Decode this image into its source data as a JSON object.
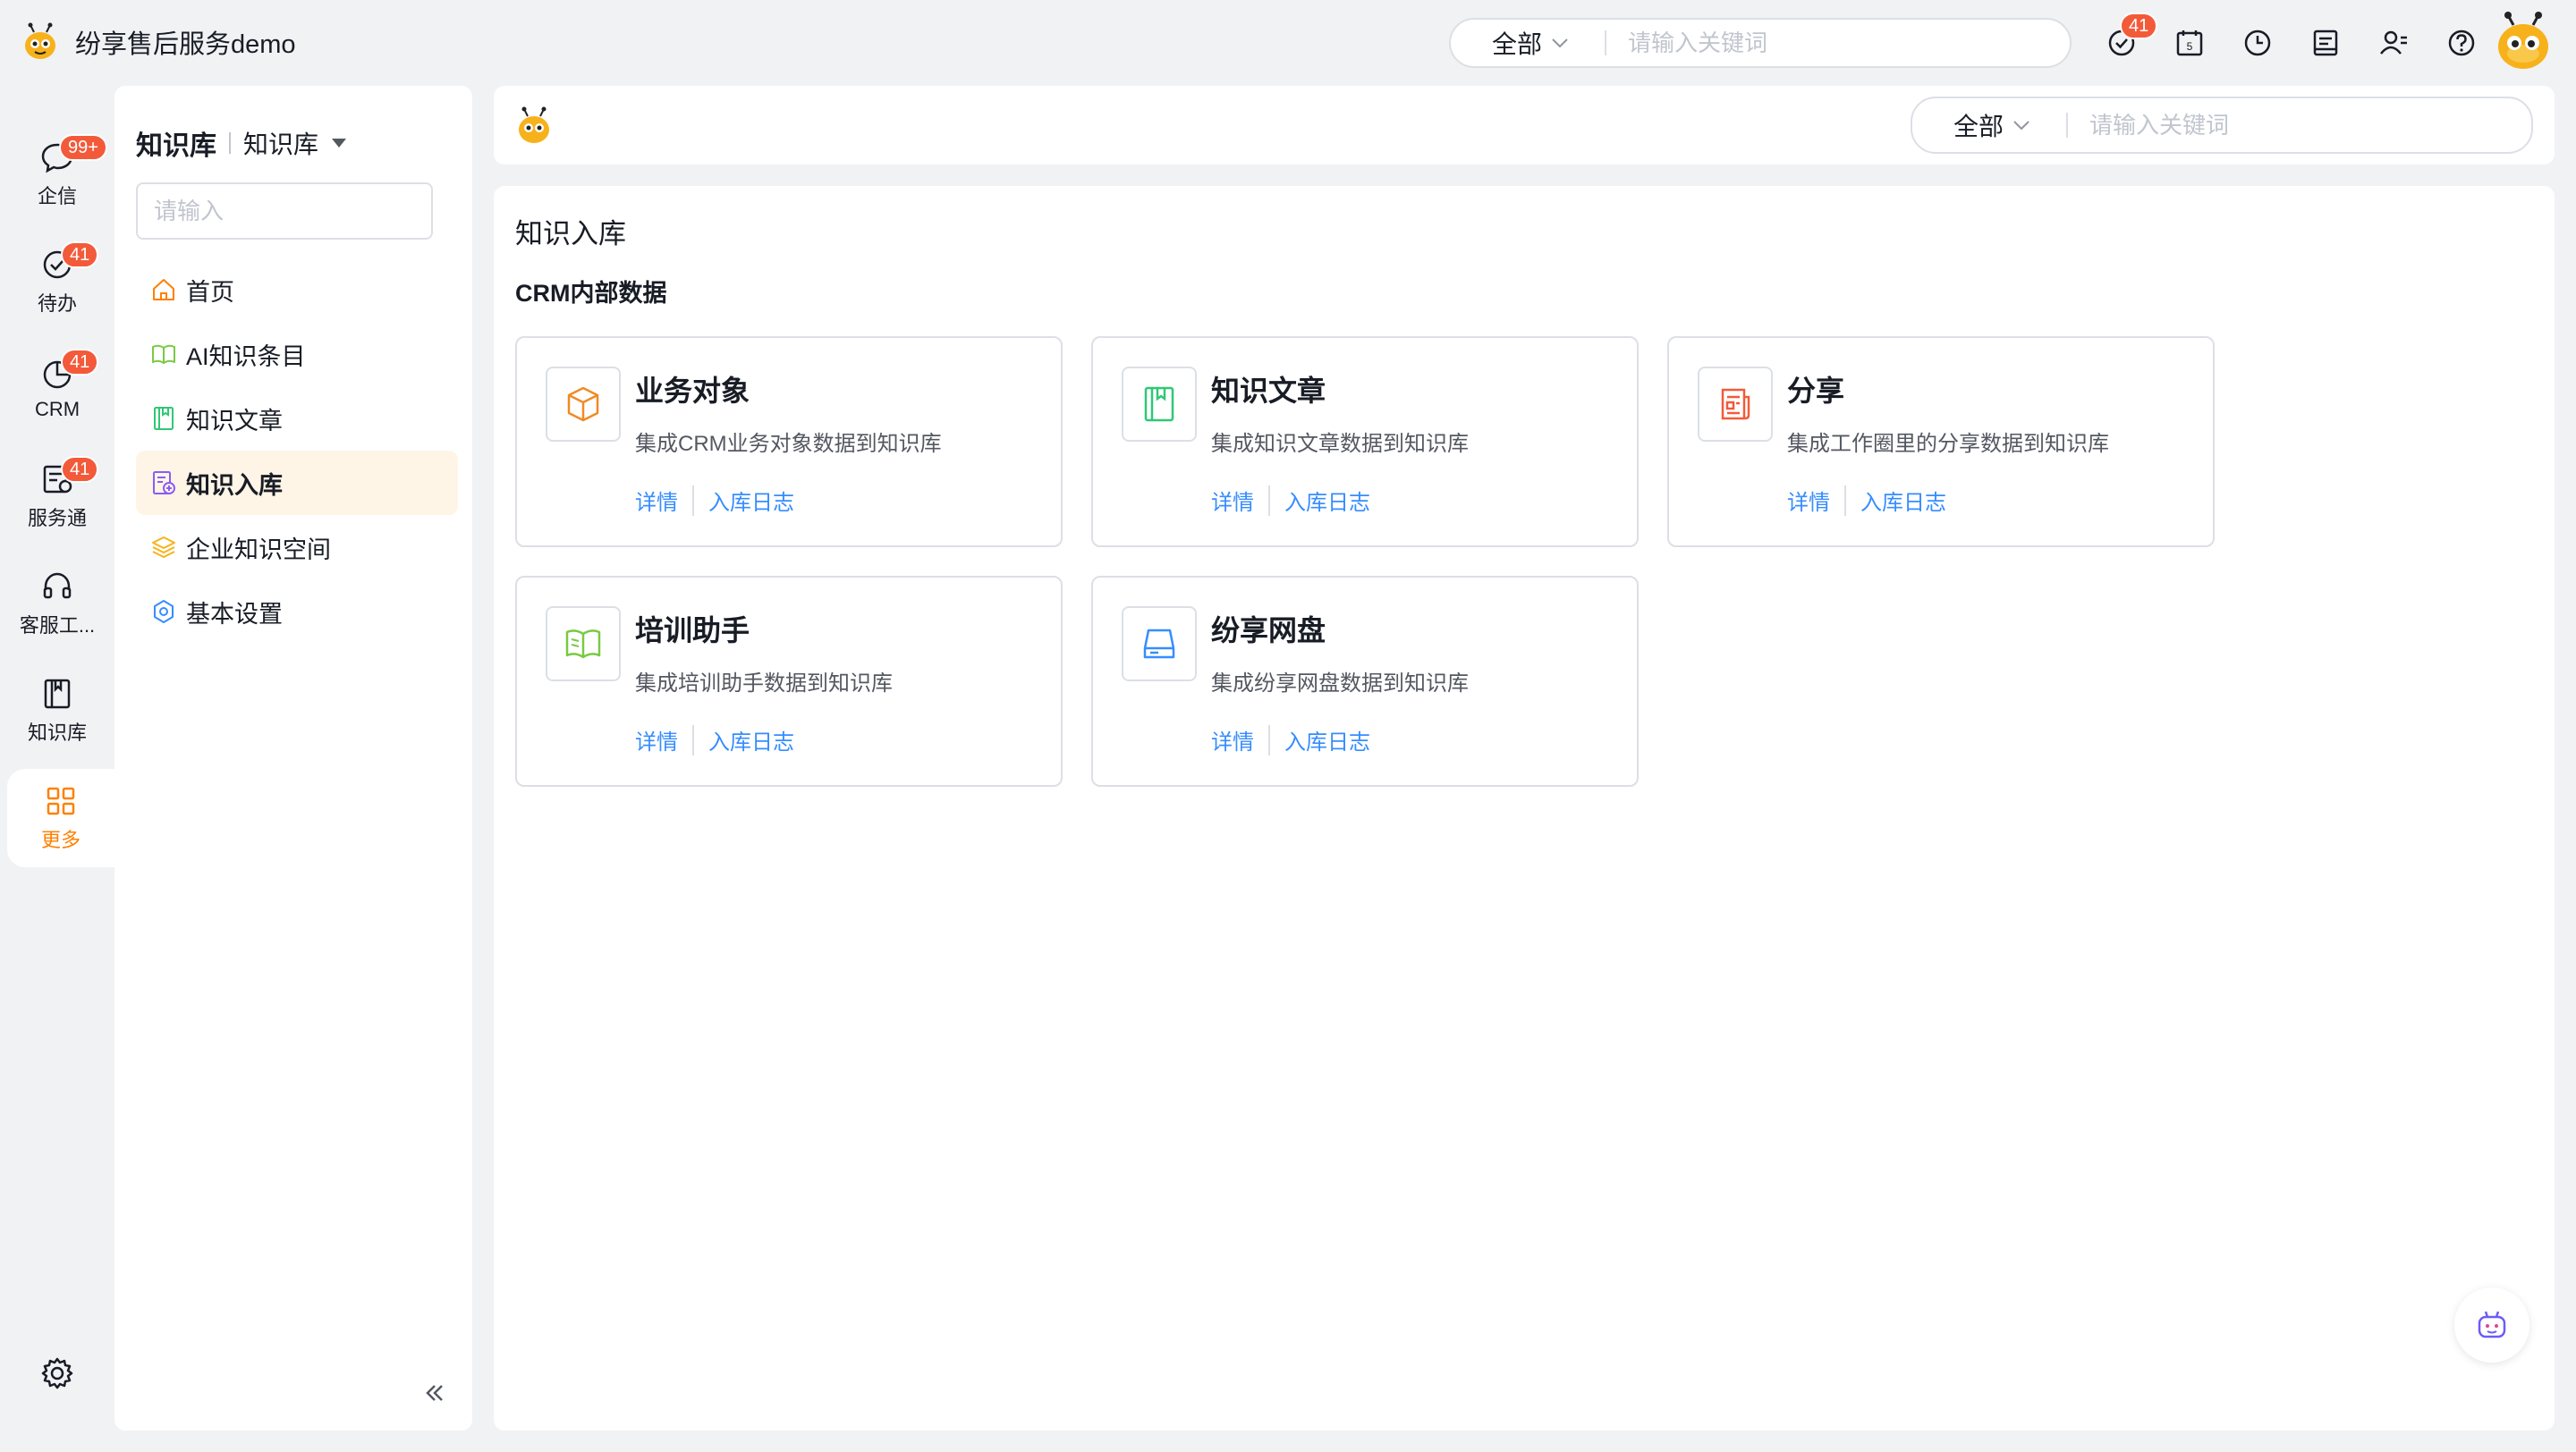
{
  "app": {
    "title": "纷享售后服务demo"
  },
  "global_search": {
    "scope": "全部",
    "placeholder": "请输入关键词"
  },
  "top_icons": [
    {
      "icon": "todo-check-icon",
      "badge": "41"
    },
    {
      "icon": "calendar-icon",
      "day": "5"
    },
    {
      "icon": "clock-icon"
    },
    {
      "icon": "report-icon"
    },
    {
      "icon": "contacts-icon"
    },
    {
      "icon": "help-icon"
    }
  ],
  "rail": {
    "items": [
      {
        "label": "企信",
        "icon": "chat-icon",
        "badge": "99+"
      },
      {
        "label": "待办",
        "icon": "todo-icon",
        "badge": "41"
      },
      {
        "label": "CRM",
        "icon": "crm-icon",
        "badge": "41"
      },
      {
        "label": "服务通",
        "icon": "service-icon",
        "badge": "41"
      },
      {
        "label": "客服工...",
        "icon": "headset-icon"
      },
      {
        "label": "知识库",
        "icon": "book-icon"
      },
      {
        "label": "更多",
        "icon": "grid-icon"
      }
    ],
    "accent": "#ff8000"
  },
  "sidenav": {
    "title": "知识库",
    "subtitle": "知识库",
    "search_placeholder": "请输入",
    "items": [
      {
        "label": "首页",
        "icon": "home-icon"
      },
      {
        "label": "AI知识条目",
        "icon": "ai-book-icon"
      },
      {
        "label": "知识文章",
        "icon": "article-icon"
      },
      {
        "label": "知识入库",
        "icon": "import-icon",
        "active": true
      },
      {
        "label": "企业知识空间",
        "icon": "layers-icon"
      },
      {
        "label": "基本设置",
        "icon": "settings-icon"
      }
    ]
  },
  "main_header": {
    "scope": "全部",
    "placeholder": "请输入关键词"
  },
  "content": {
    "page_title": "知识入库",
    "section_title": "CRM内部数据",
    "cards": [
      {
        "title": "业务对象",
        "desc": "集成CRM业务对象数据到知识库",
        "icon": "cube-icon",
        "detail": "详情",
        "log": "入库日志"
      },
      {
        "title": "知识文章",
        "desc": "集成知识文章数据到知识库",
        "icon": "article-icon",
        "detail": "详情",
        "log": "入库日志"
      },
      {
        "title": "分享",
        "desc": "集成工作圈里的分享数据到知识库",
        "icon": "share-doc-icon",
        "detail": "详情",
        "log": "入库日志"
      },
      {
        "title": "培训助手",
        "desc": "集成培训助手数据到知识库",
        "icon": "open-book-icon",
        "detail": "详情",
        "log": "入库日志"
      },
      {
        "title": "纷享网盘",
        "desc": "集成纷享网盘数据到知识库",
        "icon": "drive-icon",
        "detail": "详情",
        "log": "入库日志"
      }
    ]
  },
  "colors": {
    "link": "#368dff",
    "badge": "#f35a3a",
    "active_bg": "#fff5e6"
  }
}
